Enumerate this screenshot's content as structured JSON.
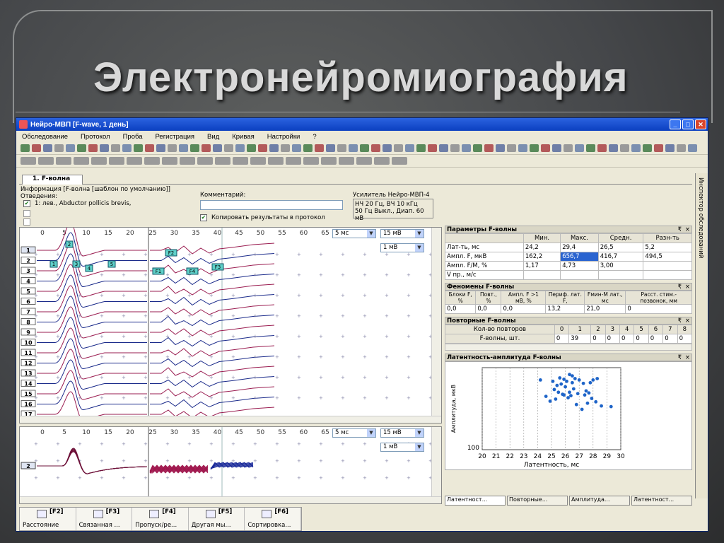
{
  "slide_title": "Электронейромиография",
  "window": {
    "title": "Нейро-МВП [F-wave, 1 день]",
    "buttons": [
      "_",
      "□",
      "✕"
    ]
  },
  "menu": [
    "Обследование",
    "Протокол",
    "Проба",
    "Регистрация",
    "Вид",
    "Кривая",
    "Настройки",
    "?"
  ],
  "tab": "1. F-волна",
  "side_tab": "Инспектор обследований",
  "info": {
    "caption": "Информация [F-волна [шаблон по умолчанию]]",
    "leads_label": "Отведения:",
    "lead_1": "1: лев., Abductor pollicis brevis,",
    "comment_label": "Комментарий:",
    "copy_label": "Копировать результаты в протокол",
    "amp_label": "Усилитель Нейро-МВП-4",
    "amp_line1": "НЧ  20 Гц, ВЧ  10 кГц",
    "amp_line2": "50 Гц  Выкл., Диап. 60 мВ"
  },
  "plot_top": {
    "x_ticks_left": [
      "0",
      "5",
      "10",
      "15",
      "20"
    ],
    "x_ticks_right": [
      "25",
      "30",
      "35",
      "40",
      "45",
      "50",
      "55",
      "60",
      "65"
    ],
    "sweep": "5 мс",
    "sens_left": "15 мВ",
    "sens_right": "1 мВ",
    "traces": [
      "1",
      "2",
      "3",
      "4",
      "5",
      "6",
      "7",
      "8",
      "9",
      "10",
      "11",
      "12",
      "13",
      "14",
      "15",
      "16",
      "17"
    ],
    "markers_m": [
      "1",
      "2",
      "3",
      "4",
      "5"
    ],
    "markers_f": [
      "F1",
      "F2",
      "F4",
      "F3"
    ]
  },
  "plot_bottom": {
    "x_ticks_left": [
      "0",
      "5",
      "10",
      "15",
      "20"
    ],
    "x_ticks_right": [
      "25",
      "30",
      "35",
      "40",
      "45",
      "50",
      "55",
      "60",
      "65"
    ],
    "sweep": "5 мс",
    "sens_left": "15 мВ",
    "sens_right": "1 мВ",
    "trace": "2"
  },
  "params": {
    "title": "Параметры F-волны",
    "headers": [
      "",
      "Мин.",
      "Макс.",
      "Средн.",
      "Разн-ть"
    ],
    "rows": [
      [
        "Лат-ть, мс",
        "24,2",
        "29,4",
        "26,5",
        "5,2"
      ],
      [
        "Ампл. F, мкВ",
        "162,2",
        "656,7",
        "416,7",
        "494,5"
      ],
      [
        "Ампл. F/M, %",
        "1,17",
        "4,73",
        "3,00",
        ""
      ],
      [
        "V пр., м/с",
        "",
        "",
        "",
        ""
      ]
    ]
  },
  "phenomena": {
    "title": "Феномены F-волны",
    "headers": [
      "Блоки F, %",
      "Повт., %",
      "Ампл. F >1 мВ, %",
      "Периф. лат. F,",
      "Fмин-М лат., мс",
      "Расст. стим.-позвонок, мм"
    ],
    "values": [
      "0,0",
      "0,0",
      "0,0",
      "13,2",
      "21,0",
      "0"
    ]
  },
  "repeats": {
    "title": "Повторные F-волны",
    "row1_label": "Кол-во повторов",
    "row1": [
      "0",
      "1",
      "2",
      "3",
      "4",
      "5",
      "6",
      "7",
      "8"
    ],
    "row2_label": "F-волны, шт.",
    "row2": [
      "0",
      "39",
      "0",
      "0",
      "0",
      "0",
      "0",
      "0",
      "0"
    ]
  },
  "latency_chart": {
    "title": "Латентность-амплитуда F-волны",
    "ylabel": "Амплитуда, мкВ",
    "xlabel": "Латентность, мс",
    "y_tick": "100"
  },
  "chart_data": {
    "type": "scatter",
    "title": "Латентность-амплитуда F-волны",
    "xlabel": "Латентность, мс",
    "ylabel": "Амплитуда, мкВ",
    "x_ticks": [
      "20",
      "21",
      "22",
      "23",
      "24",
      "25",
      "26",
      "27",
      "28",
      "29",
      "30"
    ],
    "xlim": [
      20,
      30
    ],
    "ylim": [
      100,
      700
    ],
    "grid": true,
    "points": [
      [
        26.5,
        640
      ],
      [
        26.7,
        620
      ],
      [
        26.3,
        650
      ],
      [
        25.9,
        615
      ],
      [
        26.1,
        600
      ],
      [
        27.0,
        610
      ],
      [
        27.3,
        585
      ],
      [
        28.0,
        610
      ],
      [
        28.3,
        620
      ],
      [
        27.8,
        590
      ],
      [
        25.7,
        580
      ],
      [
        26.0,
        560
      ],
      [
        26.6,
        545
      ],
      [
        25.4,
        570
      ],
      [
        25.2,
        540
      ],
      [
        25.5,
        520
      ],
      [
        25.8,
        505
      ],
      [
        26.4,
        495
      ],
      [
        26.9,
        510
      ],
      [
        27.4,
        500
      ],
      [
        27.9,
        475
      ],
      [
        28.2,
        450
      ],
      [
        27.6,
        440
      ],
      [
        26.2,
        480
      ],
      [
        24.6,
        490
      ],
      [
        24.9,
        455
      ],
      [
        25.3,
        470
      ],
      [
        26.8,
        430
      ],
      [
        28.6,
        420
      ],
      [
        29.3,
        415
      ],
      [
        27.2,
        395
      ],
      [
        24.2,
        610
      ],
      [
        25.1,
        600
      ],
      [
        25.6,
        625
      ],
      [
        26.5,
        590
      ],
      [
        27.5,
        530
      ],
      [
        27.7,
        515
      ],
      [
        26.3,
        520
      ],
      [
        25.9,
        500
      ]
    ]
  },
  "bottom_tabs": [
    "Латентност...",
    "Повторные...",
    "Амплитуда...",
    "Латентност..."
  ],
  "fkeys": [
    {
      "key": "[F2]",
      "label": "Расстояние"
    },
    {
      "key": "[F3]",
      "label": "Связанная ..."
    },
    {
      "key": "[F4]",
      "label": "Пропуск/ре..."
    },
    {
      "key": "[F5]",
      "label": "Другая мы..."
    },
    {
      "key": "[F6]",
      "label": "Сортировка..."
    }
  ]
}
